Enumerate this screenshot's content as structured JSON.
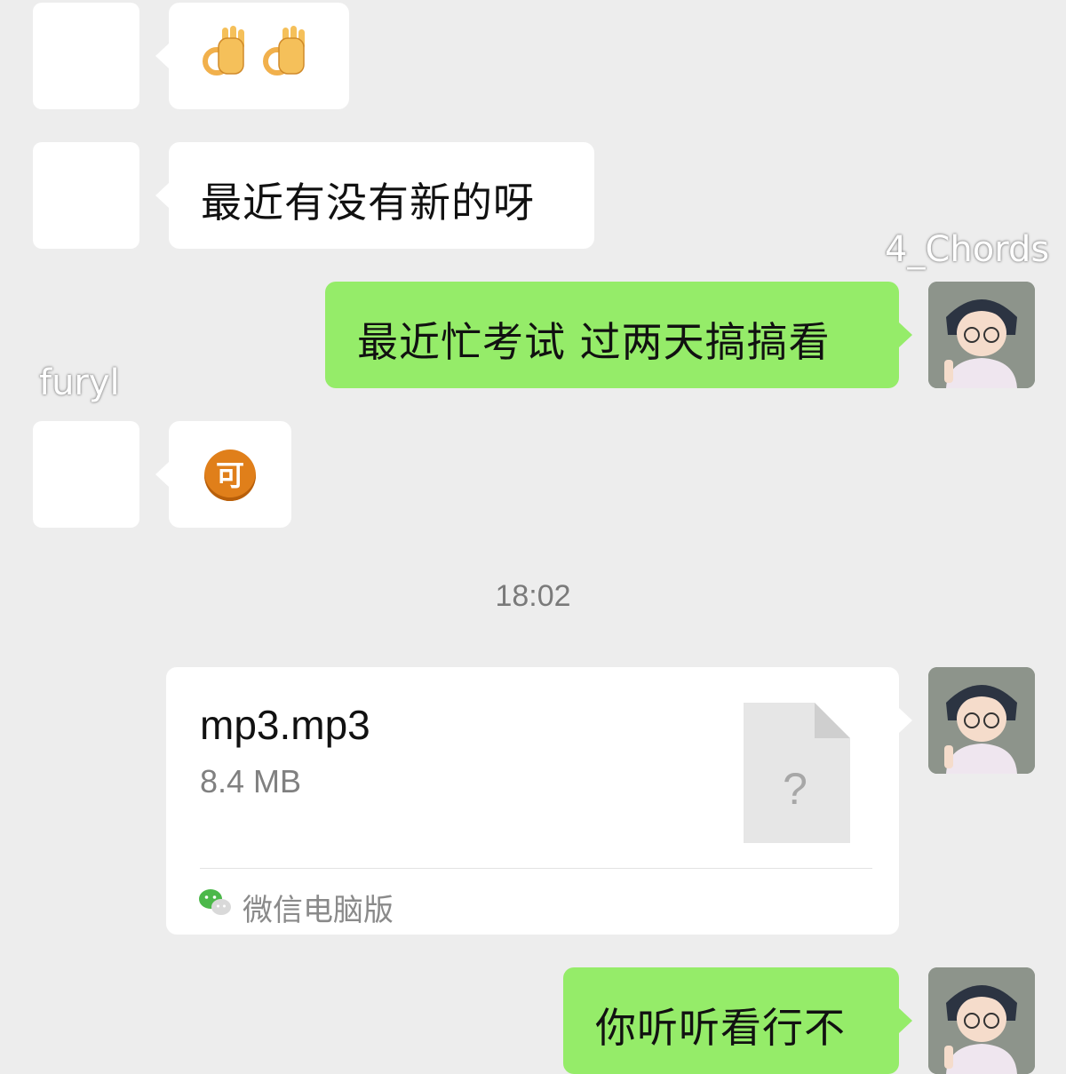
{
  "colors": {
    "background": "#ededed",
    "incoming_bubble": "#ffffff",
    "outgoing_bubble": "#95ec69",
    "timestamp_text": "#7a7a7a",
    "file_size_text": "#808080"
  },
  "chat": {
    "names": {
      "self": "4_Chords",
      "contact": "furyl"
    },
    "messages": [
      {
        "side": "in",
        "type": "emoji",
        "emoji": "ok-hand-emoji",
        "text": "👌👌"
      },
      {
        "side": "in",
        "type": "text",
        "text": "最近有没有新的呀"
      },
      {
        "side": "out",
        "type": "text",
        "text": "最近忙考试 过两天搞搞看"
      },
      {
        "side": "in",
        "type": "emoji",
        "emoji": "ke-badge-emoji",
        "text": "可"
      },
      {
        "type": "timestamp",
        "text": "18:02"
      },
      {
        "side": "out",
        "type": "file",
        "file_name": "mp3.mp3",
        "file_size": "8.4 MB",
        "file_icon": "unknown-file-icon",
        "file_icon_glyph": "?",
        "source": "微信电脑版",
        "source_icon": "wechat-icon"
      },
      {
        "side": "out",
        "type": "text",
        "text": "你听听看行不"
      }
    ]
  }
}
